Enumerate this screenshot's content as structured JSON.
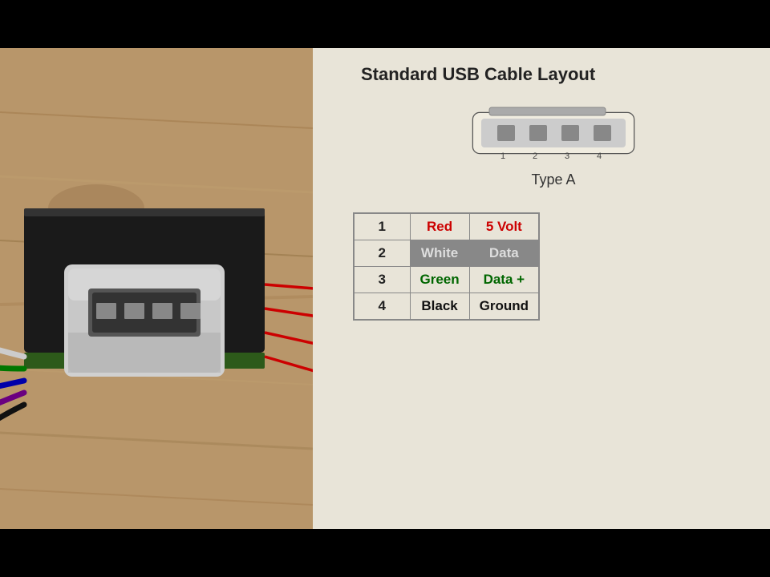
{
  "bars": {
    "top_color": "#000",
    "bottom_color": "#000"
  },
  "diagram": {
    "title": "Standard USB Cable Layout",
    "type_label": "Type A",
    "connector_pins": [
      {
        "num": "1",
        "name": "Red",
        "func": "5 Volt",
        "name_class": "pin-red-name",
        "func_class": "pin-red-func"
      },
      {
        "num": "2",
        "name": "White",
        "func": "Data",
        "name_class": "pin-white-name",
        "func_class": "pin-white-func"
      },
      {
        "num": "3",
        "name": "Green",
        "func": "Data +",
        "name_class": "pin-green-name",
        "func_class": "pin-green-func"
      },
      {
        "num": "4",
        "name": "Black",
        "func": "Ground",
        "name_class": "pin-black-name",
        "func_class": "pin-black-func"
      }
    ],
    "x_mark": "✕"
  }
}
